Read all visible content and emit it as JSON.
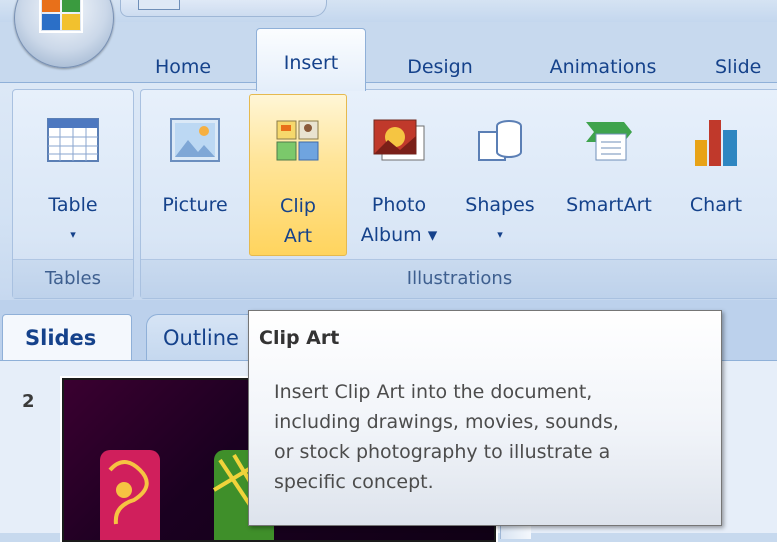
{
  "ribbon_tabs": [
    {
      "label": "Home",
      "active": false
    },
    {
      "label": "Insert",
      "active": true
    },
    {
      "label": "Design",
      "active": false
    },
    {
      "label": "Animations",
      "active": false
    },
    {
      "label": "Slide",
      "active": false
    }
  ],
  "groups": {
    "tables": {
      "label": "Tables",
      "table_button": {
        "label": "Table",
        "dropdown": "▾"
      }
    },
    "illustrations": {
      "label": "Illustrations",
      "picture": "Picture",
      "clip_art": {
        "line1": "Clip",
        "line2": "Art"
      },
      "photo_album": {
        "line1": "Photo",
        "line2": "Album ▾"
      },
      "shapes": {
        "label": "Shapes",
        "dropdown": "▾"
      },
      "smartart": "SmartArt",
      "chart": "Chart"
    }
  },
  "pane": {
    "tabs": [
      "Slides",
      "Outline"
    ],
    "slide_number": "2"
  },
  "tooltip": {
    "title": "Clip Art",
    "lines": [
      "Insert Clip Art into the document,",
      "including drawings, movies, sounds,",
      "or stock photography to illustrate a",
      "specific concept."
    ]
  },
  "colors": {
    "tab_text": "#15428b",
    "hover_highlight": "#ffd45e",
    "ribbon_bg": "#d3e2f4"
  }
}
